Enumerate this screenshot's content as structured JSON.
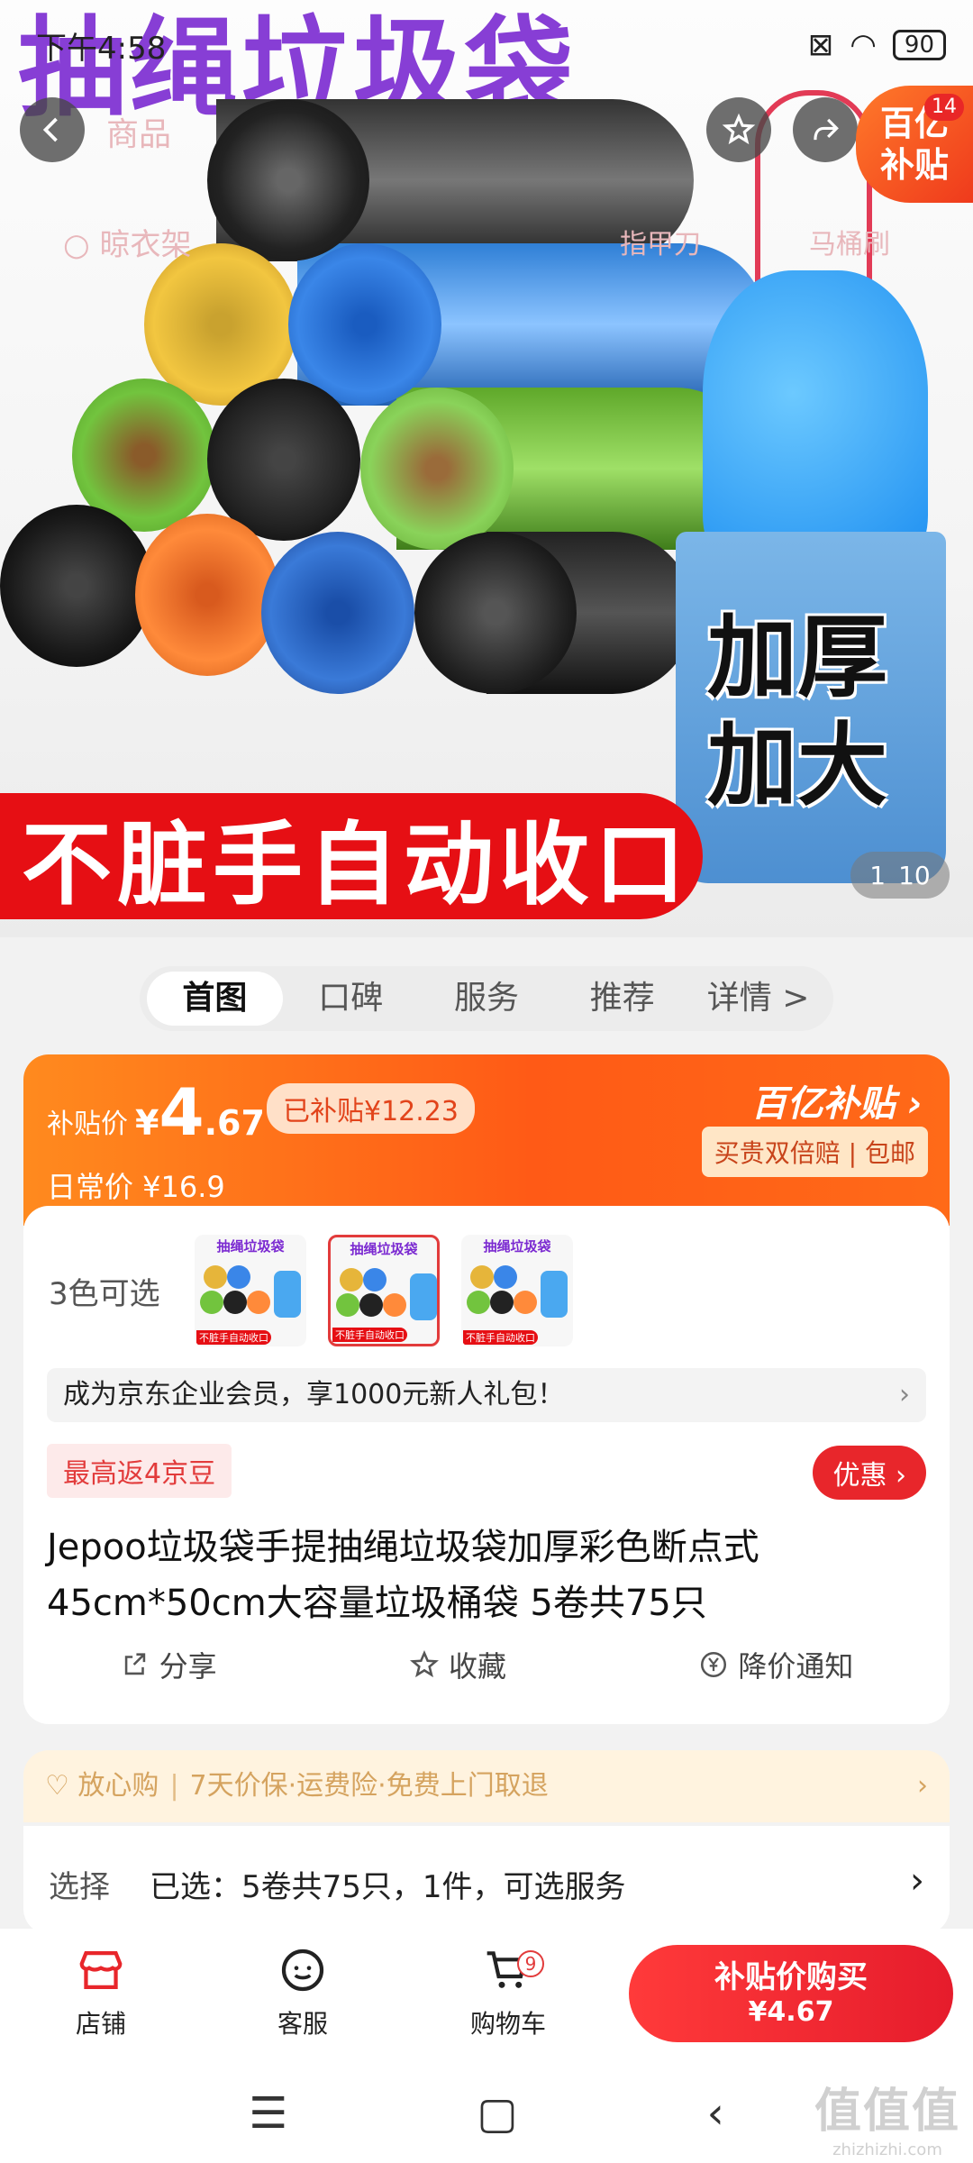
{
  "status_bar": {
    "time": "下午4:58",
    "battery": "90"
  },
  "hero": {
    "title_text": "抽绳垃圾袋",
    "banner_text": "不脏手自动收口",
    "bin_text_line1": "加厚",
    "bin_text_line2": "加大",
    "pager_current": "1",
    "pager_total": "10",
    "subsidy_line1": "百亿",
    "subsidy_line2": "补贴",
    "subsidy_badge": "14"
  },
  "top_nav": {
    "faded_title": "商品",
    "faded_search": "晾衣架",
    "faded_mid": "指甲刀",
    "faded_right": "马桶刷"
  },
  "tabs": [
    {
      "label": "首图"
    },
    {
      "label": "口碑"
    },
    {
      "label": "服务"
    },
    {
      "label": "推荐"
    },
    {
      "label": "详情 >"
    }
  ],
  "price": {
    "label": "补贴价",
    "currency": "¥",
    "integer": "4",
    "decimal": ".67",
    "subsidized_pill": "已补贴¥12.23",
    "daily_price": "日常价 ¥16.9",
    "brand": "百亿补贴 ›",
    "guarantee": "买贵双倍赔 | 包邮"
  },
  "product": {
    "colors_label": "3色可选",
    "thumb_title": "抽绳垃圾袋",
    "thumb_banner": "不脏手自动收口",
    "member_text": "成为京东企业会员，享1000元新人礼包！",
    "member_arrow": "›",
    "jd_tag": "最高返4京豆",
    "youhui": "优惠 ›",
    "title": "Jepoo垃圾袋手提抽绳垃圾袋加厚彩色断点式45cm*50cm大容量垃圾桶袋 5卷共75只",
    "actions": [
      {
        "label": "分享"
      },
      {
        "label": "收藏"
      },
      {
        "label": "降价通知"
      }
    ]
  },
  "assurance": {
    "label": "♡ 放心购",
    "items": "7天价保·运费险·免费上门取退",
    "arrow": "›"
  },
  "selection": {
    "label": "选择",
    "value": "已选：5卷共75只，1件，可选服务",
    "arrow": "›"
  },
  "bottom_bar": {
    "shop": "店铺",
    "service": "客服",
    "cart": "购物车",
    "cart_count": "9",
    "buy_line1": "补贴价购买",
    "buy_line2": "¥4.67"
  },
  "watermark": {
    "line1": "值值值",
    "line2": "zhizhizhi.com"
  },
  "colors": {
    "accent": "#e8262b",
    "orange": "#ff6a18",
    "brand_purple": "#7b2ad1"
  }
}
